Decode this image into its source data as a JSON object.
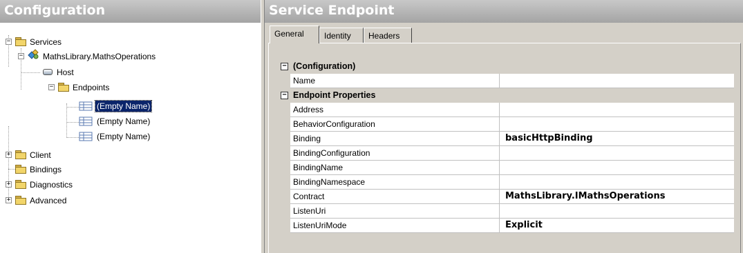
{
  "left_pane": {
    "title": "Configuration",
    "tree": {
      "services": "Services",
      "service_name": "MathsLibrary.MathsOperations",
      "host": "Host",
      "endpoints": "Endpoints",
      "endpoint_items": [
        "(Empty Name)",
        "(Empty Name)",
        "(Empty Name)"
      ],
      "client": "Client",
      "bindings": "Bindings",
      "diagnostics": "Diagnostics",
      "advanced": "Advanced"
    }
  },
  "right_pane": {
    "title": "Service Endpoint",
    "tabs": [
      "General",
      "Identity",
      "Headers"
    ],
    "categories": {
      "configuration": "(Configuration)",
      "endpoint_properties": "Endpoint Properties"
    },
    "properties": {
      "name": {
        "label": "Name",
        "value": ""
      },
      "address": {
        "label": "Address",
        "value": ""
      },
      "behavior_configuration": {
        "label": "BehaviorConfiguration",
        "value": ""
      },
      "binding": {
        "label": "Binding",
        "value": "basicHttpBinding"
      },
      "binding_configuration": {
        "label": "BindingConfiguration",
        "value": ""
      },
      "binding_name": {
        "label": "BindingName",
        "value": ""
      },
      "binding_namespace": {
        "label": "BindingNamespace",
        "value": ""
      },
      "contract": {
        "label": "Contract",
        "value": "MathsLibrary.IMathsOperations"
      },
      "listen_uri": {
        "label": "ListenUri",
        "value": ""
      },
      "listen_uri_mode": {
        "label": "ListenUriMode",
        "value": "Explicit"
      }
    }
  }
}
